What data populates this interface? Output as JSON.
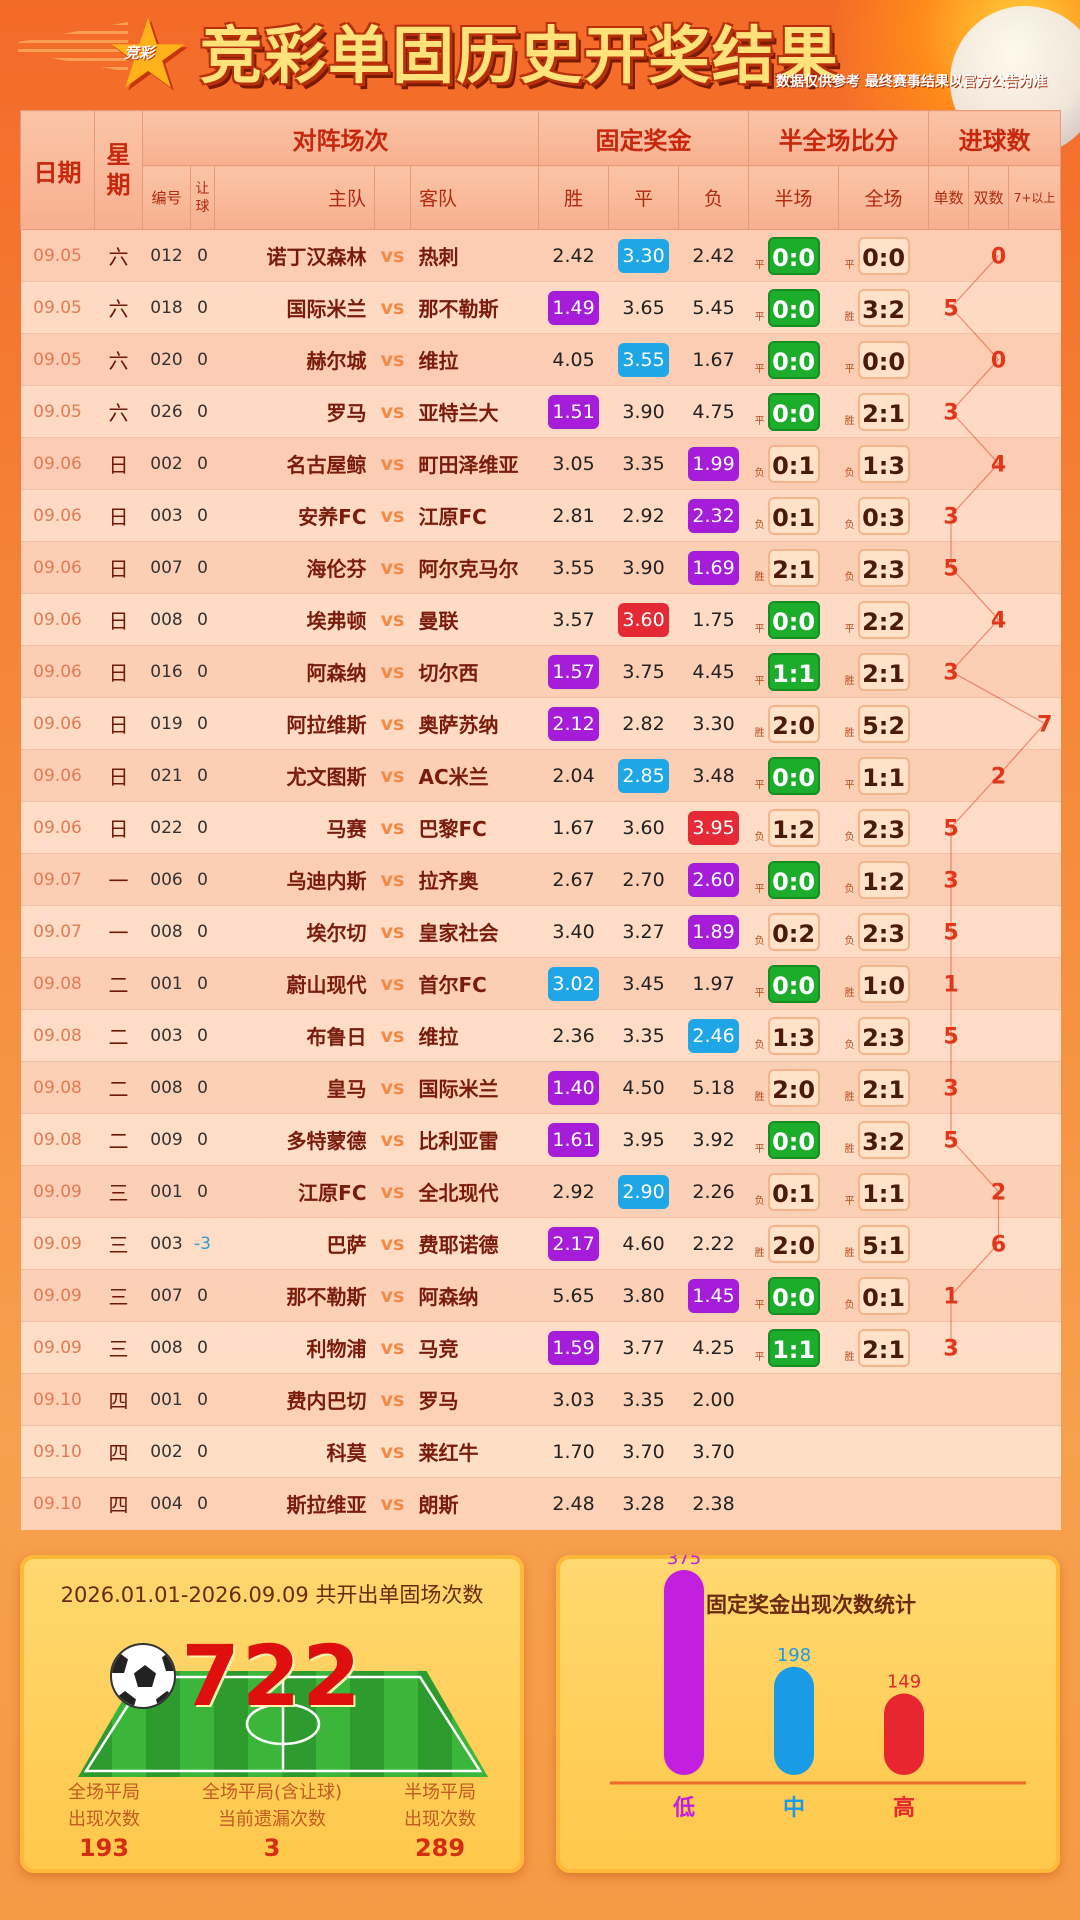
{
  "header": {
    "logo_text": "竞彩",
    "title": "竞彩单固历史开奖结果",
    "disclaimer": "数据仅供参考 最终赛事结果以官方公告为准"
  },
  "table_header": {
    "date": "日期",
    "weekday": "星期",
    "matchup": "对阵场次",
    "fixed_odds": "固定奖金",
    "half_full": "半全场比分",
    "goals": "进球数",
    "code": "编号",
    "handicap": "让球",
    "home": "主队",
    "away": "客队",
    "win": "胜",
    "draw": "平",
    "lose": "负",
    "half": "半场",
    "full": "全场",
    "odd": "单数",
    "even": "双数",
    "seven_plus": "7+以上",
    "vs": "vs"
  },
  "colors": {
    "low_badge": "#a51dd8",
    "mid_badge": "#1ea6e6",
    "high_badge": "#e62a35",
    "score_green": "#1dad2c",
    "goal_line": "#e0361a"
  },
  "rows": [
    {
      "date": "09.05",
      "wd": "六",
      "code": "012",
      "hcp": "0",
      "home": "诺丁汉森林",
      "away": "热刺",
      "win": "2.42",
      "draw": "3.30",
      "lose": "2.42",
      "hl": "draw",
      "hl_level": "mid",
      "half_res": "平",
      "half": "0:0",
      "full_res": "平",
      "full": "0:0",
      "goals": "0"
    },
    {
      "date": "09.05",
      "wd": "六",
      "code": "018",
      "hcp": "0",
      "home": "国际米兰",
      "away": "那不勒斯",
      "win": "1.49",
      "draw": "3.65",
      "lose": "5.45",
      "hl": "win",
      "hl_level": "low",
      "half_res": "平",
      "half": "0:0",
      "full_res": "胜",
      "full": "3:2",
      "goals": "5"
    },
    {
      "date": "09.05",
      "wd": "六",
      "code": "020",
      "hcp": "0",
      "home": "赫尔城",
      "away": "维拉",
      "win": "4.05",
      "draw": "3.55",
      "lose": "1.67",
      "hl": "draw",
      "hl_level": "mid",
      "half_res": "平",
      "half": "0:0",
      "full_res": "平",
      "full": "0:0",
      "goals": "0"
    },
    {
      "date": "09.05",
      "wd": "六",
      "code": "026",
      "hcp": "0",
      "home": "罗马",
      "away": "亚特兰大",
      "win": "1.51",
      "draw": "3.90",
      "lose": "4.75",
      "hl": "win",
      "hl_level": "low",
      "half_res": "平",
      "half": "0:0",
      "full_res": "胜",
      "full": "2:1",
      "goals": "3"
    },
    {
      "date": "09.06",
      "wd": "日",
      "code": "002",
      "hcp": "0",
      "home": "名古屋鲸",
      "away": "町田泽维亚",
      "win": "3.05",
      "draw": "3.35",
      "lose": "1.99",
      "hl": "lose",
      "hl_level": "low",
      "half_res": "负",
      "half": "0:1",
      "full_res": "负",
      "full": "1:3",
      "goals": "4"
    },
    {
      "date": "09.06",
      "wd": "日",
      "code": "003",
      "hcp": "0",
      "home": "安养FC",
      "away": "江原FC",
      "win": "2.81",
      "draw": "2.92",
      "lose": "2.32",
      "hl": "lose",
      "hl_level": "low",
      "half_res": "负",
      "half": "0:1",
      "full_res": "负",
      "full": "0:3",
      "goals": "3"
    },
    {
      "date": "09.06",
      "wd": "日",
      "code": "007",
      "hcp": "0",
      "home": "海伦芬",
      "away": "阿尔克马尔",
      "win": "3.55",
      "draw": "3.90",
      "lose": "1.69",
      "hl": "lose",
      "hl_level": "low",
      "half_res": "胜",
      "half": "2:1",
      "full_res": "负",
      "full": "2:3",
      "goals": "5"
    },
    {
      "date": "09.06",
      "wd": "日",
      "code": "008",
      "hcp": "0",
      "home": "埃弗顿",
      "away": "曼联",
      "win": "3.57",
      "draw": "3.60",
      "lose": "1.75",
      "hl": "draw",
      "hl_level": "high",
      "half_res": "平",
      "half": "0:0",
      "full_res": "平",
      "full": "2:2",
      "goals": "4"
    },
    {
      "date": "09.06",
      "wd": "日",
      "code": "016",
      "hcp": "0",
      "home": "阿森纳",
      "away": "切尔西",
      "win": "1.57",
      "draw": "3.75",
      "lose": "4.45",
      "hl": "win",
      "hl_level": "low",
      "half_res": "平",
      "half": "1:1",
      "full_res": "胜",
      "full": "2:1",
      "goals": "3"
    },
    {
      "date": "09.06",
      "wd": "日",
      "code": "019",
      "hcp": "0",
      "home": "阿拉维斯",
      "away": "奥萨苏纳",
      "win": "2.12",
      "draw": "2.82",
      "lose": "3.30",
      "hl": "win",
      "hl_level": "low",
      "half_res": "胜",
      "half": "2:0",
      "full_res": "胜",
      "full": "5:2",
      "goals": "7"
    },
    {
      "date": "09.06",
      "wd": "日",
      "code": "021",
      "hcp": "0",
      "home": "尤文图斯",
      "away": "AC米兰",
      "win": "2.04",
      "draw": "2.85",
      "lose": "3.48",
      "hl": "draw",
      "hl_level": "mid",
      "half_res": "平",
      "half": "0:0",
      "full_res": "平",
      "full": "1:1",
      "goals": "2"
    },
    {
      "date": "09.06",
      "wd": "日",
      "code": "022",
      "hcp": "0",
      "home": "马赛",
      "away": "巴黎FC",
      "win": "1.67",
      "draw": "3.60",
      "lose": "3.95",
      "hl": "lose",
      "hl_level": "high",
      "half_res": "负",
      "half": "1:2",
      "full_res": "负",
      "full": "2:3",
      "goals": "5"
    },
    {
      "date": "09.07",
      "wd": "一",
      "code": "006",
      "hcp": "0",
      "home": "乌迪内斯",
      "away": "拉齐奥",
      "win": "2.67",
      "draw": "2.70",
      "lose": "2.60",
      "hl": "lose",
      "hl_level": "low",
      "half_res": "平",
      "half": "0:0",
      "full_res": "负",
      "full": "1:2",
      "goals": "3"
    },
    {
      "date": "09.07",
      "wd": "一",
      "code": "008",
      "hcp": "0",
      "home": "埃尔切",
      "away": "皇家社会",
      "win": "3.40",
      "draw": "3.27",
      "lose": "1.89",
      "hl": "lose",
      "hl_level": "low",
      "half_res": "负",
      "half": "0:2",
      "full_res": "负",
      "full": "2:3",
      "goals": "5"
    },
    {
      "date": "09.08",
      "wd": "二",
      "code": "001",
      "hcp": "0",
      "home": "蔚山现代",
      "away": "首尔FC",
      "win": "3.02",
      "draw": "3.45",
      "lose": "1.97",
      "hl": "win",
      "hl_level": "mid",
      "half_res": "平",
      "half": "0:0",
      "full_res": "胜",
      "full": "1:0",
      "goals": "1"
    },
    {
      "date": "09.08",
      "wd": "二",
      "code": "003",
      "hcp": "0",
      "home": "布鲁日",
      "away": "维拉",
      "win": "2.36",
      "draw": "3.35",
      "lose": "2.46",
      "hl": "lose",
      "hl_level": "mid",
      "half_res": "负",
      "half": "1:3",
      "full_res": "负",
      "full": "2:3",
      "goals": "5"
    },
    {
      "date": "09.08",
      "wd": "二",
      "code": "008",
      "hcp": "0",
      "home": "皇马",
      "away": "国际米兰",
      "win": "1.40",
      "draw": "4.50",
      "lose": "5.18",
      "hl": "win",
      "hl_level": "low",
      "half_res": "胜",
      "half": "2:0",
      "full_res": "胜",
      "full": "2:1",
      "goals": "3"
    },
    {
      "date": "09.08",
      "wd": "二",
      "code": "009",
      "hcp": "0",
      "home": "多特蒙德",
      "away": "比利亚雷",
      "win": "1.61",
      "draw": "3.95",
      "lose": "3.92",
      "hl": "win",
      "hl_level": "low",
      "half_res": "平",
      "half": "0:0",
      "full_res": "胜",
      "full": "3:2",
      "goals": "5"
    },
    {
      "date": "09.09",
      "wd": "三",
      "code": "001",
      "hcp": "0",
      "home": "江原FC",
      "away": "全北现代",
      "win": "2.92",
      "draw": "2.90",
      "lose": "2.26",
      "hl": "draw",
      "hl_level": "mid",
      "half_res": "负",
      "half": "0:1",
      "full_res": "平",
      "full": "1:1",
      "goals": "2"
    },
    {
      "date": "09.09",
      "wd": "三",
      "code": "003",
      "hcp": "-3",
      "home": "巴萨",
      "away": "费耶诺德",
      "win": "2.17",
      "draw": "4.60",
      "lose": "2.22",
      "hl": "win",
      "hl_level": "low",
      "half_res": "胜",
      "half": "2:0",
      "full_res": "胜",
      "full": "5:1",
      "goals": "6"
    },
    {
      "date": "09.09",
      "wd": "三",
      "code": "007",
      "hcp": "0",
      "home": "那不勒斯",
      "away": "阿森纳",
      "win": "5.65",
      "draw": "3.80",
      "lose": "1.45",
      "hl": "lose",
      "hl_level": "low",
      "half_res": "平",
      "half": "0:0",
      "full_res": "负",
      "full": "0:1",
      "goals": "1"
    },
    {
      "date": "09.09",
      "wd": "三",
      "code": "008",
      "hcp": "0",
      "home": "利物浦",
      "away": "马竞",
      "win": "1.59",
      "draw": "3.77",
      "lose": "4.25",
      "hl": "win",
      "hl_level": "low",
      "half_res": "平",
      "half": "1:1",
      "full_res": "胜",
      "full": "2:1",
      "goals": "3"
    },
    {
      "date": "09.10",
      "wd": "四",
      "code": "001",
      "hcp": "0",
      "home": "费内巴切",
      "away": "罗马",
      "win": "3.03",
      "draw": "3.35",
      "lose": "2.00",
      "hl": "",
      "hl_level": "",
      "half_res": "",
      "half": "",
      "full_res": "",
      "full": "",
      "goals": ""
    },
    {
      "date": "09.10",
      "wd": "四",
      "code": "002",
      "hcp": "0",
      "home": "科莫",
      "away": "莱红牛",
      "win": "1.70",
      "draw": "3.70",
      "lose": "3.70",
      "hl": "",
      "hl_level": "",
      "half_res": "",
      "half": "",
      "full_res": "",
      "full": "",
      "goals": ""
    },
    {
      "date": "09.10",
      "wd": "四",
      "code": "004",
      "hcp": "0",
      "home": "斯拉维亚",
      "away": "朗斯",
      "win": "2.48",
      "draw": "3.28",
      "lose": "2.38",
      "hl": "",
      "hl_level": "",
      "half_res": "",
      "half": "",
      "full_res": "",
      "full": "",
      "goals": ""
    }
  ],
  "summary": {
    "range_text": "2026.01.01-2026.09.09 共开出单固场次数",
    "total": "722",
    "stats": [
      {
        "l1": "全场平局",
        "l2": "出现次数",
        "value": "193"
      },
      {
        "l1": "全场平局(含让球)",
        "l2": "当前遗漏次数",
        "value": "3"
      },
      {
        "l1": "半场平局",
        "l2": "出现次数",
        "value": "289"
      }
    ]
  },
  "chart_data": {
    "type": "bar",
    "title": "固定奖金出现次数统计",
    "categories": [
      "低",
      "中",
      "高"
    ],
    "values": [
      375,
      198,
      149
    ],
    "colors": [
      "#c21fe0",
      "#1a9be6",
      "#e8262f"
    ],
    "ylim": [
      0,
      375
    ],
    "grid": false
  }
}
